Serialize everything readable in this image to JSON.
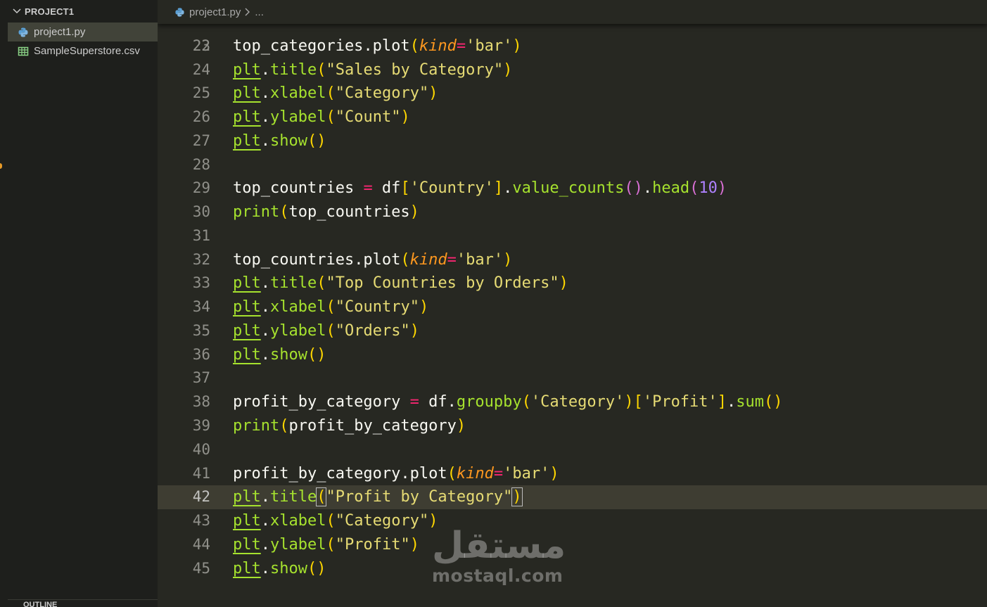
{
  "sidebar": {
    "section_title": "PROJECT1",
    "files": [
      {
        "name": "project1.py",
        "icon": "python-file-icon",
        "selected": true
      },
      {
        "name": "SampleSuperstore.csv",
        "icon": "csv-file-icon",
        "selected": false
      }
    ],
    "outline_title": "OUTLINE"
  },
  "editor": {
    "breadcrumb": {
      "file": "project1.py",
      "ellipsis": "..."
    },
    "partial_top_line_number": "22",
    "current_line": "42",
    "lines": [
      {
        "n": "23",
        "tokens": [
          [
            "var",
            "top_categories"
          ],
          [
            "var",
            ".plot"
          ],
          [
            "p1",
            "("
          ],
          [
            "kw",
            "kind"
          ],
          [
            "op",
            "="
          ],
          [
            "str",
            "'bar'"
          ],
          [
            "p1",
            ")"
          ]
        ]
      },
      {
        "n": "24",
        "tokens": [
          [
            "mod",
            "plt"
          ],
          [
            "var",
            "."
          ],
          [
            "fn",
            "title"
          ],
          [
            "p1",
            "("
          ],
          [
            "str",
            "\"Sales by Category\""
          ],
          [
            "p1",
            ")"
          ]
        ]
      },
      {
        "n": "25",
        "tokens": [
          [
            "mod",
            "plt"
          ],
          [
            "var",
            "."
          ],
          [
            "fn",
            "xlabel"
          ],
          [
            "p1",
            "("
          ],
          [
            "str",
            "\"Category\""
          ],
          [
            "p1",
            ")"
          ]
        ]
      },
      {
        "n": "26",
        "tokens": [
          [
            "mod",
            "plt"
          ],
          [
            "var",
            "."
          ],
          [
            "fn",
            "ylabel"
          ],
          [
            "p1",
            "("
          ],
          [
            "str",
            "\"Count\""
          ],
          [
            "p1",
            ")"
          ]
        ]
      },
      {
        "n": "27",
        "tokens": [
          [
            "mod",
            "plt"
          ],
          [
            "var",
            "."
          ],
          [
            "fn",
            "show"
          ],
          [
            "p1",
            "()"
          ]
        ]
      },
      {
        "n": "28",
        "tokens": []
      },
      {
        "n": "29",
        "tokens": [
          [
            "var",
            "top_countries "
          ],
          [
            "op",
            "="
          ],
          [
            "var",
            " df"
          ],
          [
            "p1",
            "["
          ],
          [
            "str",
            "'Country'"
          ],
          [
            "p1",
            "]"
          ],
          [
            "var",
            "."
          ],
          [
            "fn",
            "value_counts"
          ],
          [
            "p2",
            "()"
          ],
          [
            "var",
            "."
          ],
          [
            "fn",
            "head"
          ],
          [
            "p2",
            "("
          ],
          [
            "num",
            "10"
          ],
          [
            "p2",
            ")"
          ]
        ]
      },
      {
        "n": "30",
        "tokens": [
          [
            "fn",
            "print"
          ],
          [
            "p1",
            "("
          ],
          [
            "var",
            "top_countries"
          ],
          [
            "p1",
            ")"
          ]
        ]
      },
      {
        "n": "31",
        "tokens": []
      },
      {
        "n": "32",
        "tokens": [
          [
            "var",
            "top_countries"
          ],
          [
            "var",
            ".plot"
          ],
          [
            "p1",
            "("
          ],
          [
            "kw",
            "kind"
          ],
          [
            "op",
            "="
          ],
          [
            "str",
            "'bar'"
          ],
          [
            "p1",
            ")"
          ]
        ]
      },
      {
        "n": "33",
        "tokens": [
          [
            "mod",
            "plt"
          ],
          [
            "var",
            "."
          ],
          [
            "fn",
            "title"
          ],
          [
            "p1",
            "("
          ],
          [
            "str",
            "\"Top Countries by Orders\""
          ],
          [
            "p1",
            ")"
          ]
        ]
      },
      {
        "n": "34",
        "tokens": [
          [
            "mod",
            "plt"
          ],
          [
            "var",
            "."
          ],
          [
            "fn",
            "xlabel"
          ],
          [
            "p1",
            "("
          ],
          [
            "str",
            "\"Country\""
          ],
          [
            "p1",
            ")"
          ]
        ]
      },
      {
        "n": "35",
        "tokens": [
          [
            "mod",
            "plt"
          ],
          [
            "var",
            "."
          ],
          [
            "fn",
            "ylabel"
          ],
          [
            "p1",
            "("
          ],
          [
            "str",
            "\"Orders\""
          ],
          [
            "p1",
            ")"
          ]
        ]
      },
      {
        "n": "36",
        "tokens": [
          [
            "mod",
            "plt"
          ],
          [
            "var",
            "."
          ],
          [
            "fn",
            "show"
          ],
          [
            "p1",
            "()"
          ]
        ]
      },
      {
        "n": "37",
        "tokens": []
      },
      {
        "n": "38",
        "tokens": [
          [
            "var",
            "profit_by_category "
          ],
          [
            "op",
            "="
          ],
          [
            "var",
            " df."
          ],
          [
            "fn",
            "groupby"
          ],
          [
            "p1",
            "("
          ],
          [
            "str",
            "'Category'"
          ],
          [
            "p1",
            ")"
          ],
          [
            "p1",
            "["
          ],
          [
            "str",
            "'Profit'"
          ],
          [
            "p1",
            "]"
          ],
          [
            "var",
            "."
          ],
          [
            "fn",
            "sum"
          ],
          [
            "p1",
            "()"
          ]
        ]
      },
      {
        "n": "39",
        "tokens": [
          [
            "fn",
            "print"
          ],
          [
            "p1",
            "("
          ],
          [
            "var",
            "profit_by_category"
          ],
          [
            "p1",
            ")"
          ]
        ]
      },
      {
        "n": "40",
        "tokens": []
      },
      {
        "n": "41",
        "tokens": [
          [
            "var",
            "profit_by_category"
          ],
          [
            "var",
            ".plot"
          ],
          [
            "p1",
            "("
          ],
          [
            "kw",
            "kind"
          ],
          [
            "op",
            "="
          ],
          [
            "str",
            "'bar'"
          ],
          [
            "p1",
            ")"
          ]
        ]
      },
      {
        "n": "42",
        "tokens": [
          [
            "mod",
            "plt"
          ],
          [
            "var",
            "."
          ],
          [
            "fn",
            "title"
          ],
          [
            "p1m",
            "("
          ],
          [
            "str",
            "\"Profit by Category\""
          ],
          [
            "p1m",
            ")"
          ]
        ]
      },
      {
        "n": "43",
        "tokens": [
          [
            "mod",
            "plt"
          ],
          [
            "var",
            "."
          ],
          [
            "fn",
            "xlabel"
          ],
          [
            "p1",
            "("
          ],
          [
            "str",
            "\"Category\""
          ],
          [
            "p1",
            ")"
          ]
        ]
      },
      {
        "n": "44",
        "tokens": [
          [
            "mod",
            "plt"
          ],
          [
            "var",
            "."
          ],
          [
            "fn",
            "ylabel"
          ],
          [
            "p1",
            "("
          ],
          [
            "str",
            "\"Profit\""
          ],
          [
            "p1",
            ")"
          ]
        ]
      },
      {
        "n": "45",
        "tokens": [
          [
            "mod",
            "plt"
          ],
          [
            "var",
            "."
          ],
          [
            "fn",
            "show"
          ],
          [
            "p1",
            "()"
          ]
        ]
      }
    ]
  },
  "watermark": {
    "arabic": "مستقل",
    "latin": "mostaql.com"
  },
  "colors": {
    "editor_bg": "#272822",
    "sidebar_bg": "#1e1f1c",
    "string": "#e6db74",
    "function": "#a6e22e",
    "keyword_arg": "#fd971f",
    "operator": "#f92672",
    "number": "#ae81ff",
    "bracket_level1": "#ffd700",
    "bracket_level2": "#da70d6"
  }
}
